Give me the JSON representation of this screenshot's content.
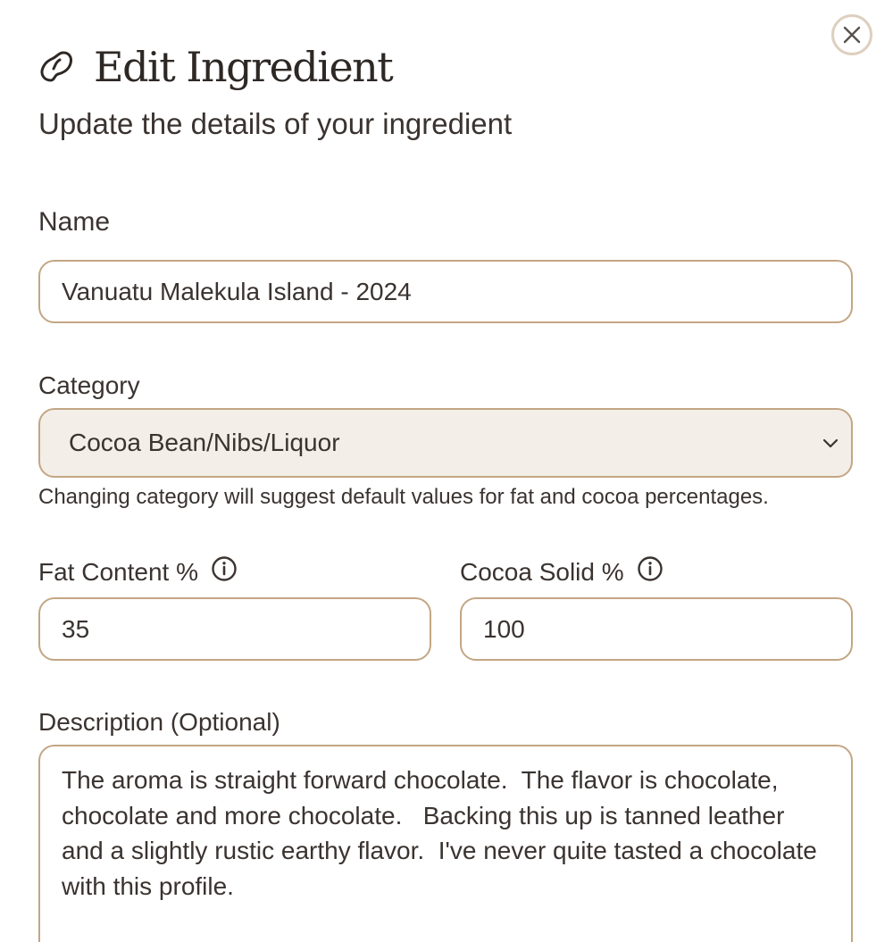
{
  "header": {
    "title": "Edit Ingredient",
    "subtitle": "Update the details of your ingredient",
    "title_icon": "bean-icon",
    "close_icon": "close-icon"
  },
  "form": {
    "name": {
      "label": "Name",
      "value": "Vanuatu Malekula Island - 2024"
    },
    "category": {
      "label": "Category",
      "value": "Cocoa Bean/Nibs/Liquor",
      "hint": "Changing category will suggest default values for fat and cocoa percentages."
    },
    "fat_content": {
      "label": "Fat Content %",
      "value": "35"
    },
    "cocoa_solid": {
      "label": "Cocoa Solid %",
      "value": "100"
    },
    "description": {
      "label": "Description (Optional)",
      "value": "The aroma is straight forward chocolate.  The flavor is chocolate, chocolate and more chocolate.   Backing this up is tanned leather and a slightly rustic earthy flavor.  I've never quite tasted a chocolate with this profile."
    }
  },
  "colors": {
    "accent_border": "#c3a684",
    "select_background": "#f3eee8",
    "close_ring": "#ddd0bf",
    "text": "#3a3330"
  }
}
